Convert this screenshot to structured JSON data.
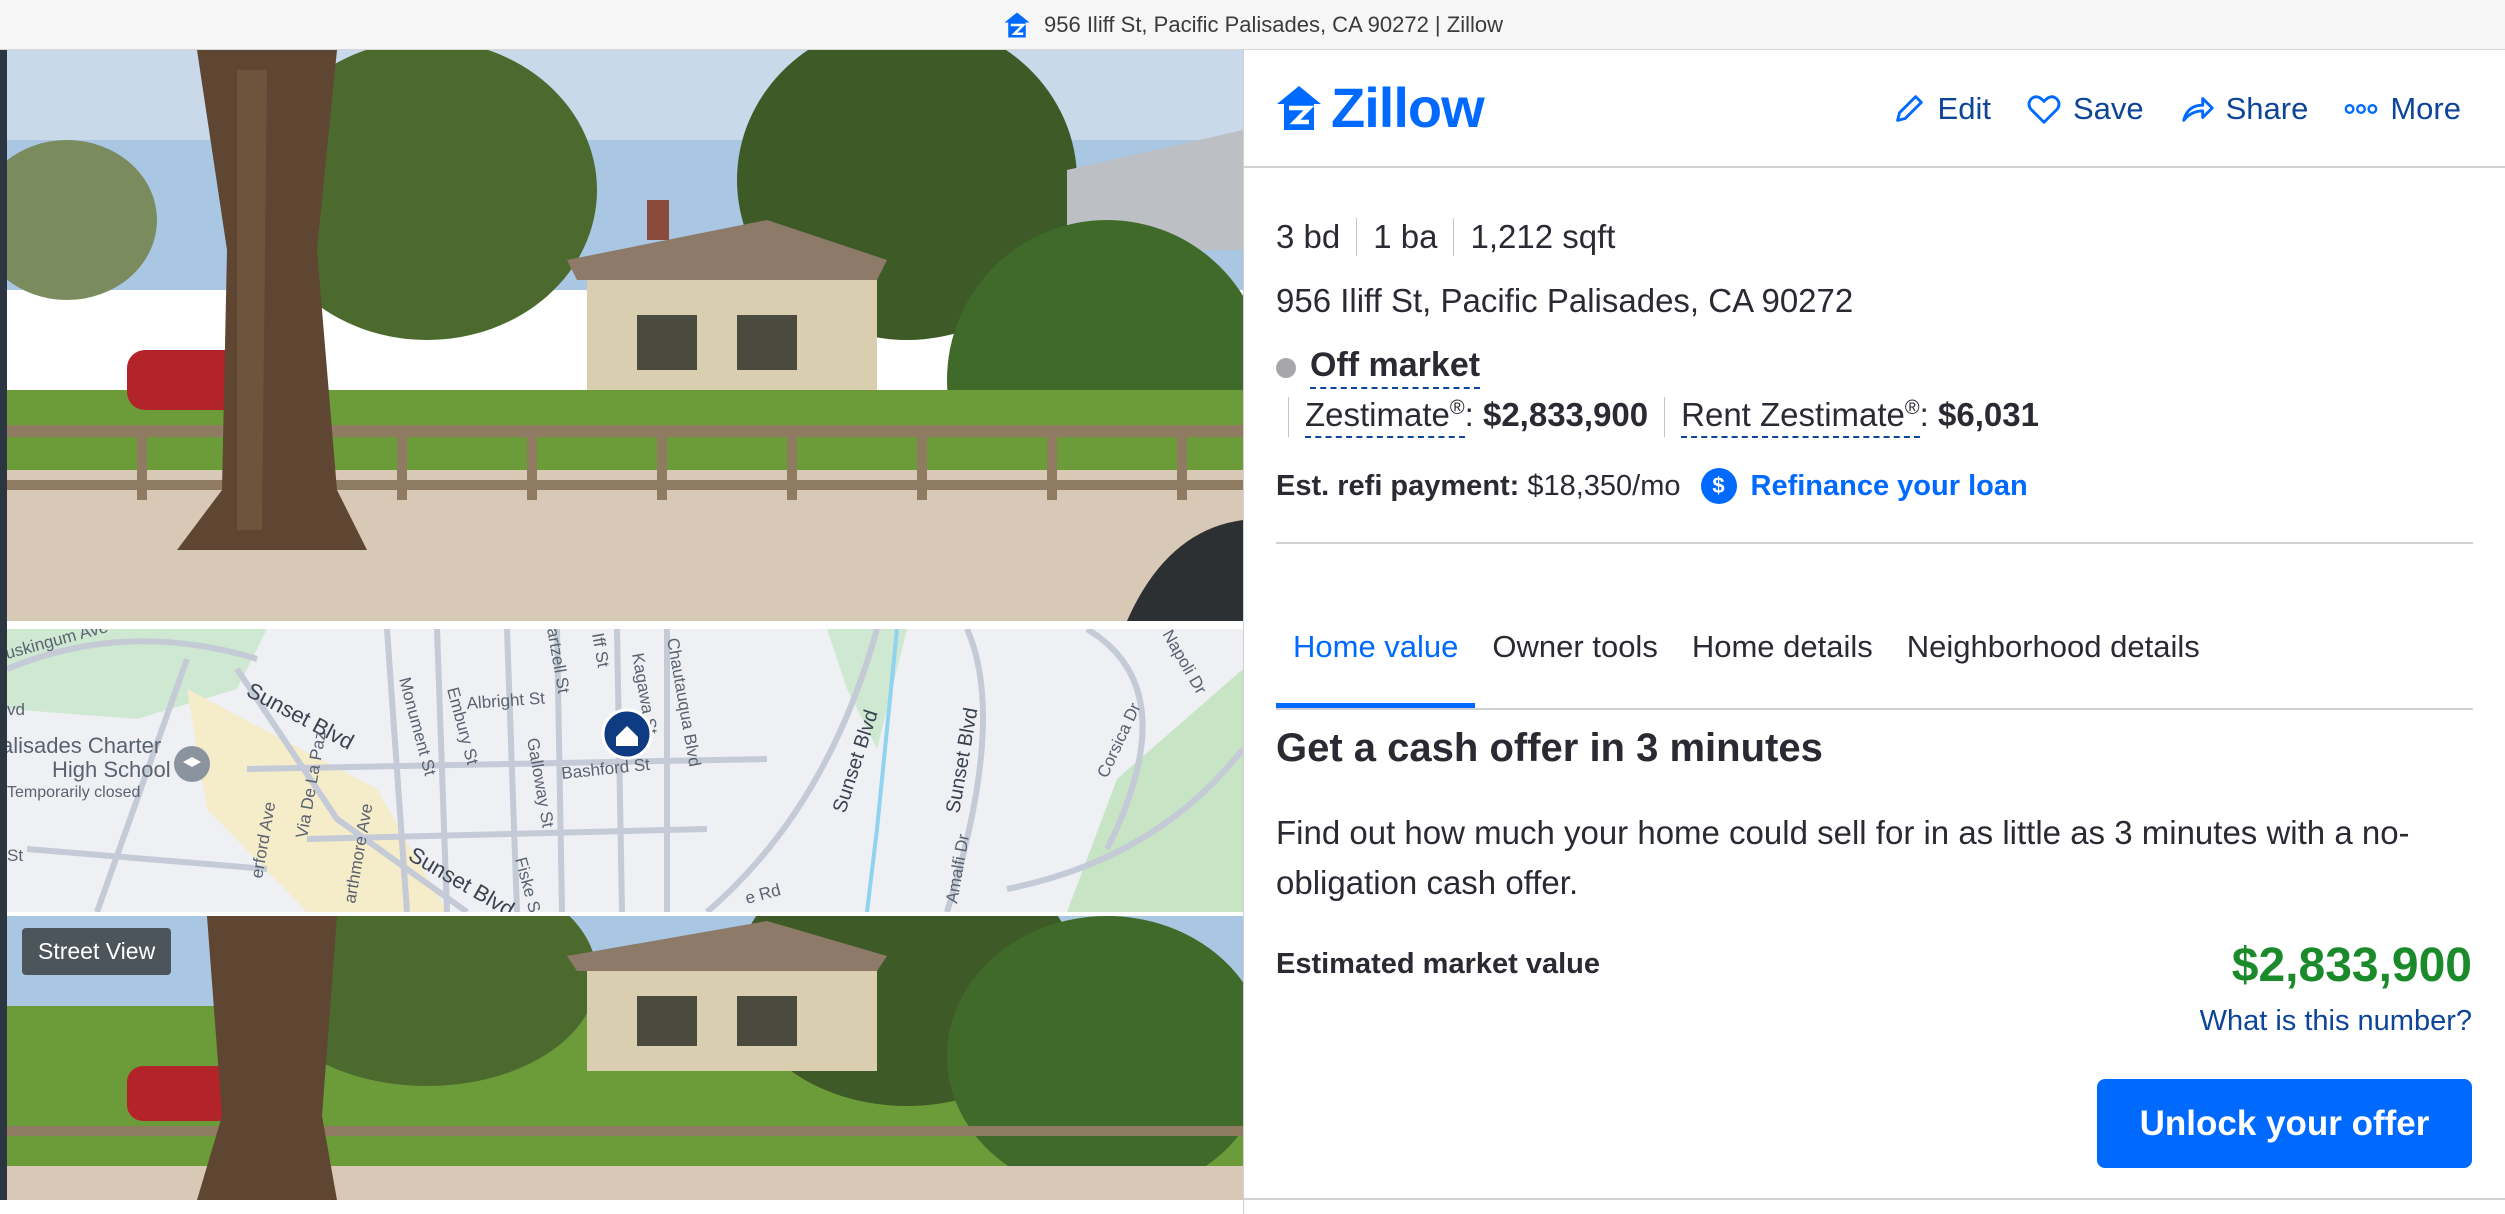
{
  "window": {
    "title": "956 Iliff St, Pacific Palisades, CA 90272 | Zillow"
  },
  "brand": {
    "name": "Zillow",
    "color": "#006aff"
  },
  "media": {
    "street_view_label": "Street View",
    "map_labels": [
      "uskingum Ave",
      "vd",
      "alisades Charter",
      "High School",
      "Temporarily closed",
      "Sunset Blvd",
      "Monument St",
      "Embury St",
      "Albright St",
      "artzell St",
      "Iff St",
      "Kagawa St",
      "Chautauqua Blvd",
      "Galloway St",
      "Bashford St",
      "Via De La Paz",
      "erford Ave",
      "arthmore Ave",
      "Sunset Blvd",
      "Fiske S",
      "e Rd",
      "Sunset Blvd",
      "Sunset Blvd",
      "Amalfi Dr",
      "Corsica Dr",
      "Napoli Dr",
      "St"
    ]
  },
  "header": {
    "actions": [
      {
        "label": "Edit",
        "icon": "pencil-icon"
      },
      {
        "label": "Save",
        "icon": "heart-icon"
      },
      {
        "label": "Share",
        "icon": "share-icon"
      },
      {
        "label": "More",
        "icon": "more-dots-icon"
      }
    ]
  },
  "property": {
    "beds": "3 bd",
    "baths": "1 ba",
    "sqft": "1,212 sqft",
    "address": "956 Iliff St, Pacific Palisades, CA 90272",
    "status": "Off market",
    "zestimate_label": "Zestimate",
    "zestimate_mark": "®",
    "zestimate_sep": ":",
    "zestimate_value": "$2,833,900",
    "rent_zestimate_label": "Rent Zestimate",
    "rent_zestimate_value": "$6,031",
    "refi_label": "Est. refi payment:",
    "refi_value": "$18,350/mo",
    "refi_icon_glyph": "$",
    "refi_link": "Refinance your loan"
  },
  "tabs": [
    {
      "label": "Home value",
      "active": true
    },
    {
      "label": "Owner tools",
      "active": false
    },
    {
      "label": "Home details",
      "active": false
    },
    {
      "label": "Neighborhood details",
      "active": false
    }
  ],
  "offer": {
    "title": "Get a cash offer in 3 minutes",
    "description": "Find out how much your home could sell for in as little as 3 minutes with a no-obligation cash offer.",
    "emv_label": "Estimated market value",
    "emv_value": "$2,833,900",
    "emv_link": "What is this number?",
    "cta_label": "Unlock your offer",
    "value_color": "#1b8a2b"
  }
}
